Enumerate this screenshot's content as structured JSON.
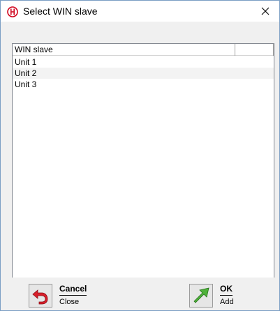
{
  "window": {
    "title": "Select WIN slave",
    "icon": "app-logo-icon",
    "close_icon": "close-icon"
  },
  "list": {
    "columns": [
      "WIN slave",
      ""
    ],
    "rows": [
      "Unit 1",
      "Unit 2",
      "Unit 3"
    ]
  },
  "footer": {
    "cancel": {
      "label": "Cancel",
      "sub": "Close",
      "icon": "undo-arrow-icon"
    },
    "ok": {
      "label": "OK",
      "sub": "Add",
      "icon": "add-arrow-icon"
    }
  },
  "colors": {
    "accent_red": "#d0021b",
    "accent_green": "#3a9a2a",
    "window_border": "#7a9ec4"
  }
}
